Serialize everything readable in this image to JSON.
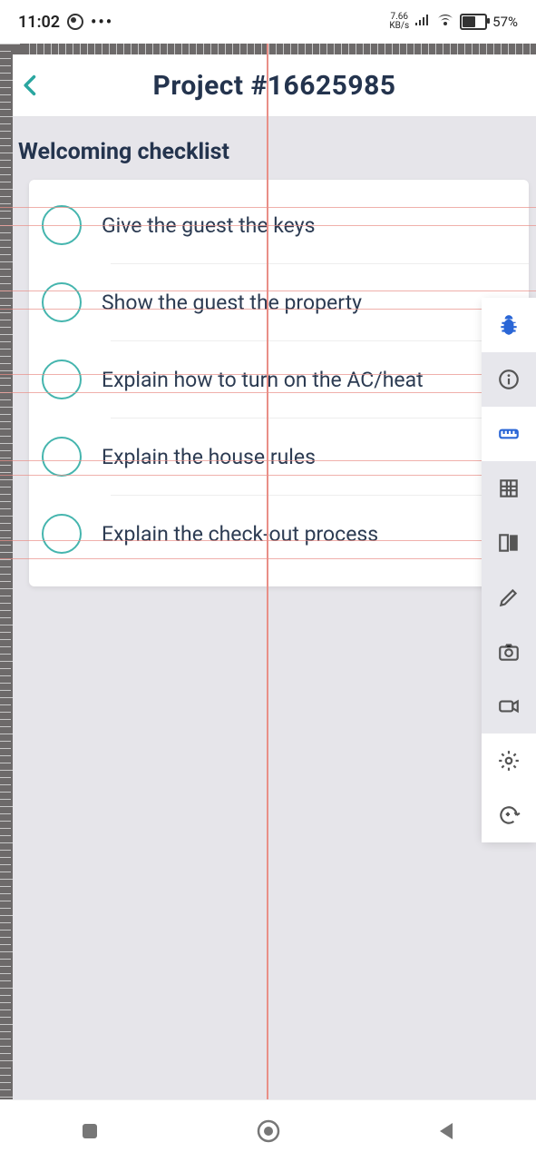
{
  "statusbar": {
    "time": "11:02",
    "kbps_top": "7.66",
    "kbps_bottom": "KB/s",
    "battery_pct": "57%"
  },
  "header": {
    "title": "Project #16625985"
  },
  "section": {
    "title": "Welcoming checklist"
  },
  "checklist": [
    {
      "label": "Give the guest the keys"
    },
    {
      "label": "Show the guest the property"
    },
    {
      "label": "Explain how to turn on the AC/heat"
    },
    {
      "label": "Explain the house rules"
    },
    {
      "label": "Explain the check-out process"
    }
  ],
  "inspector": {
    "tools": [
      {
        "name": "bug-icon"
      },
      {
        "name": "info-icon"
      },
      {
        "name": "ruler-icon"
      },
      {
        "name": "grid-icon"
      },
      {
        "name": "compare-icon"
      },
      {
        "name": "pencil-icon"
      },
      {
        "name": "camera-icon"
      },
      {
        "name": "video-icon"
      },
      {
        "name": "settings-icon"
      },
      {
        "name": "rotate-icon"
      }
    ]
  },
  "guides": {
    "h_rows": [
      228,
      248,
      320,
      340,
      412,
      432,
      507,
      523,
      595,
      615
    ]
  }
}
